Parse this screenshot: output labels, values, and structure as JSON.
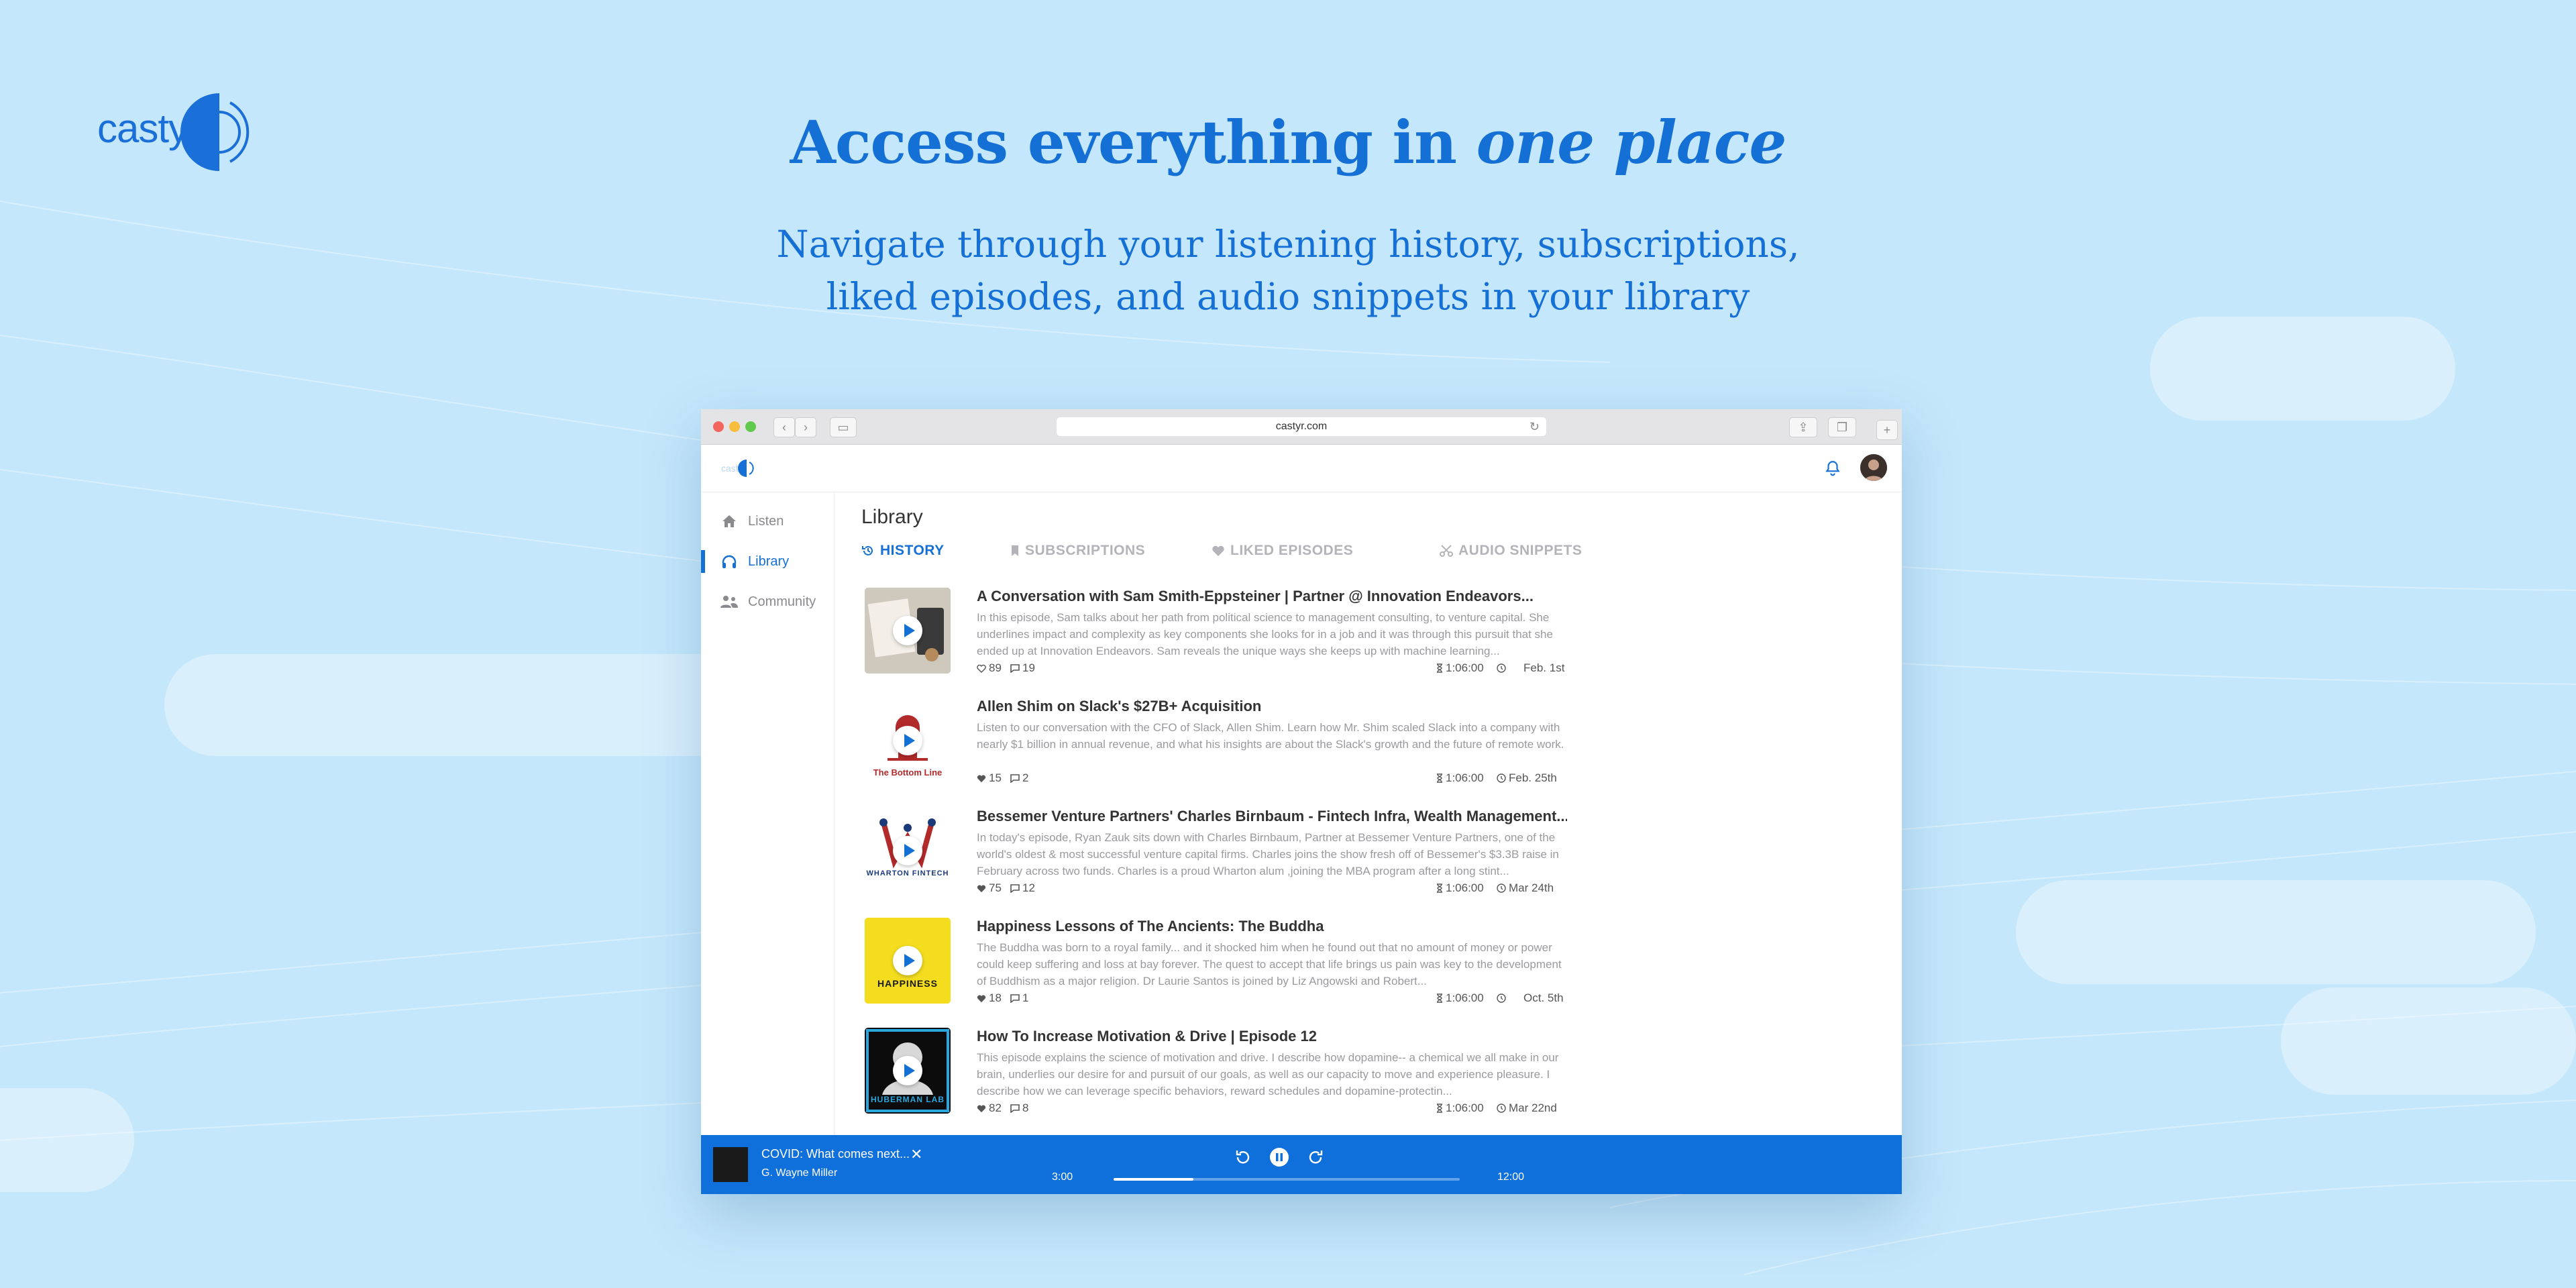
{
  "brand": {
    "name": "castyr"
  },
  "hero": {
    "headline_start": "Access everything in ",
    "headline_emph": "one place",
    "subhead_line1": "Navigate through your listening history, subscriptions,",
    "subhead_line2": "liked episodes, and audio snippets in your library"
  },
  "browser": {
    "url": "castyr.com"
  },
  "sidebar": {
    "items": [
      {
        "label": "Listen",
        "icon": "home-icon",
        "active": false
      },
      {
        "label": "Library",
        "icon": "headphones-icon",
        "active": true
      },
      {
        "label": "Community",
        "icon": "people-icon",
        "active": false
      }
    ]
  },
  "library": {
    "title": "Library",
    "tabs": [
      {
        "label": "HISTORY",
        "icon": "history-icon",
        "active": true
      },
      {
        "label": "SUBSCRIPTIONS",
        "icon": "bookmark-icon",
        "active": false
      },
      {
        "label": "LIKED EPISODES",
        "icon": "heart-icon",
        "active": false
      },
      {
        "label": "AUDIO SNIPPETS",
        "icon": "scissors-icon",
        "active": false
      }
    ],
    "episodes": [
      {
        "title": "A Conversation with Sam Smith-Eppsteiner | Partner @ Innovation Endeavors...",
        "description": "In this episode, Sam talks about her path from political science to management consulting, to venture capital. She underlines impact and complexity as key components she looks for in a job and it was through this pursuit that she ended up at Innovation Endeavors. Sam reveals the unique ways she keeps up with machine learning...",
        "likes": "89",
        "comments": "19",
        "duration": "1:06:00",
        "date": "Feb. 1st",
        "thumb_text": "",
        "thumb_bg": "#d9d4cc"
      },
      {
        "title": "Allen Shim on Slack's $27B+ Acquisition",
        "description": "Listen to our conversation with the CFO of Slack, Allen Shim. Learn how Mr. Shim scaled Slack into a company with nearly $1 billion in annual revenue, and what his insights are about the Slack's growth and the future of remote work.",
        "likes": "15",
        "comments": "2",
        "duration": "1:06:00",
        "date": "Feb. 25th",
        "thumb_text": "The Bottom Line",
        "thumb_bg": "#ffffff"
      },
      {
        "title": "Bessemer Venture Partners' Charles Birnbaum - Fintech Infra, Wealth Management...",
        "description": "In today's episode, Ryan Zauk sits down with Charles Birnbaum, Partner at Bessemer Venture Partners, one of the world's oldest & most successful venture capital firms. Charles joins the show fresh off of Bessemer's $3.3B raise in February across two funds. Charles is a proud Wharton alum ,joining the MBA program after a long stint...",
        "likes": "75",
        "comments": "12",
        "duration": "1:06:00",
        "date": "Mar 24th",
        "thumb_text": "WHARTON FINTECH",
        "thumb_bg": "#ffffff"
      },
      {
        "title": "Happiness Lessons of The Ancients: The Buddha",
        "description": "The Buddha was born to a royal family... and it shocked him when he found out that no amount of money or power could keep suffering and loss at bay forever. The quest to accept that life brings us pain was key to the development of Buddhism as a major religion. Dr Laurie Santos is joined by Liz Angowski and Robert...",
        "likes": "18",
        "comments": "1",
        "duration": "1:06:00",
        "date": "Oct. 5th",
        "thumb_text": "HAPPINESS",
        "thumb_bg": "#f4dd1f"
      },
      {
        "title": "How To Increase Motivation & Drive | Episode 12",
        "description": "This episode explains the science of motivation and drive. I describe how dopamine-- a chemical we all make in our brain, underlies our desire for and pursuit of our goals, as well as our capacity to move and experience pleasure. I describe how we can leverage specific behaviors, reward schedules and dopamine-protectin...",
        "likes": "82",
        "comments": "8",
        "duration": "1:06:00",
        "date": "Mar 22nd",
        "thumb_text": "HUBERMAN LAB",
        "thumb_bg": "#ffffff"
      }
    ]
  },
  "player": {
    "title": "COVID: What comes next...",
    "author": "G. Wayne Miller",
    "elapsed": "3:00",
    "total": "12:00",
    "progress": 0.23
  },
  "colors": {
    "accent": "#1570d6",
    "background": "#c5e7fb"
  }
}
